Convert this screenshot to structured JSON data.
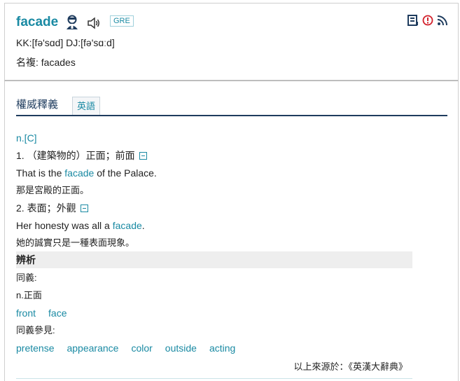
{
  "header": {
    "word": "facade",
    "badge": "GRE",
    "pronunciation": "KK:[fə'sɑd] DJ:[fə'sɑːd]",
    "plural": "名複: facades",
    "icons": [
      "person-icon",
      "speaker-icon",
      "bookmark-icon",
      "report-icon",
      "rss-icon"
    ]
  },
  "tabs": {
    "active": "權威釋義",
    "english": "英語"
  },
  "definition": {
    "pos": "n.[C]",
    "sense1": "1. （建築物的）正面；前面",
    "ex1_before": "That is the ",
    "ex1_word": "facade",
    "ex1_after": " of the Palace.",
    "ex1_zh": "那是宮殿的正面。",
    "sense2": "2. 表面；外觀",
    "ex2_before": "Her honesty was all a ",
    "ex2_word": "facade",
    "ex2_after": ".",
    "ex2_zh": "她的誠實只是一種表面現象。"
  },
  "analysis": {
    "title": "辨析",
    "synonyms_label": "同義:",
    "synonyms_pos": "n.正面",
    "synonyms": [
      "front",
      "face"
    ],
    "see_also_label": "同義參見:",
    "see_also": [
      "pretense",
      "appearance",
      "color",
      "outside",
      "acting"
    ],
    "source": "以上來源於：《英漢大辭典》"
  },
  "colors": {
    "accent": "#1a8aa3",
    "navy": "#1f3c5e"
  }
}
